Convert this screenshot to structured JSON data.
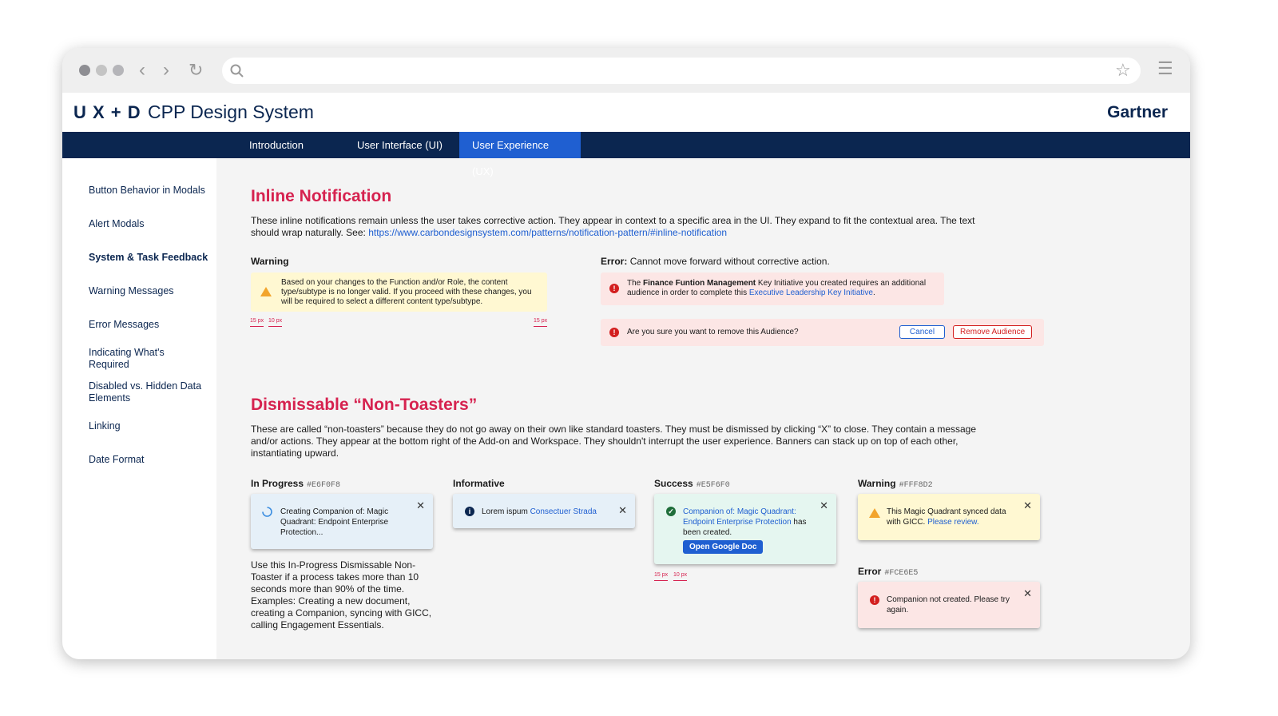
{
  "app": {
    "title": "CPP Design System",
    "logo": "U X + D",
    "brand": "Gartner"
  },
  "nav": {
    "tabs": [
      {
        "label": "Introduction"
      },
      {
        "label": "User Interface (UI)"
      },
      {
        "label": "User Experience (UX)",
        "active": true
      }
    ]
  },
  "sidebar": {
    "items": [
      {
        "label": "Button Behavior in Modals"
      },
      {
        "label": "Alert Modals"
      },
      {
        "label": "System & Task Feedback",
        "active": true
      },
      {
        "label": "Warning Messages"
      },
      {
        "label": "Error Messages"
      },
      {
        "label": "Indicating What's Required"
      },
      {
        "label": "Disabled vs. Hidden Data Elements"
      },
      {
        "label": "Linking"
      },
      {
        "label": "Date Format"
      }
    ]
  },
  "inline": {
    "title": "Inline Notification",
    "desc": "These inline notifications remain unless the user takes corrective action. They appear in context to a specific area in the UI. They expand to fit the contextual area. The text should wrap naturally. See: ",
    "link": "https://www.carbondesignsystem.com/patterns/notification-pattern/#inline-notification",
    "warning_label": "Warning",
    "warning_text": "Based on your changes to the Function and/or Role, the content type/subtype is no longer valid. If you proceed with these changes, you will be required to select a different content type/subtype.",
    "measure": [
      "15 px",
      "10 px",
      "15 px"
    ],
    "error_label_bold": "Error:",
    "error_label": "Cannot move forward without corrective action.",
    "error1": {
      "pre": "The ",
      "bold": "Finance Funtion Management",
      "mid": " Key Initiative you created requires an additional audience in order to complete this ",
      "link": "Executive Leadership Key Initiative",
      "post": "."
    },
    "error2": {
      "text": "Are you sure you want to remove this Audience?",
      "cancel": "Cancel",
      "remove": "Remove Audience"
    }
  },
  "toasters": {
    "title": "Dismissable “Non-Toasters”",
    "desc": "These are called “non-toasters” because they do not go away on their own like standard toasters. They must be dismissed by clicking “X” to close. They contain a message and/or actions. They appear at the bottom right of the Add-on and Workspace. They shouldn't interrupt the user experience. Banners can stack up on top of each other, instantiating upward.",
    "progress": {
      "label": "In Progress",
      "hex": "#E6F0F8",
      "text": "Creating Companion of: Magic Quadrant: Endpoint Enterprise Protection...",
      "note": "Use this In-Progress Dismissable Non-Toaster if a process takes more than 10 seconds more than 90% of the time. Examples: Creating a new document, creating a Companion, syncing with GICC, calling Engagement Essentials."
    },
    "info": {
      "label": "Informative",
      "text": "Lorem ispum ",
      "link": "Consectuer Strada"
    },
    "success": {
      "label": "Success",
      "hex": "#E5F6F0",
      "link": "Companion of: Magic Quadrant: Endpoint Enterprise Protection",
      "text": " has been created.",
      "button": "Open Google Doc",
      "measure": [
        "15 px",
        "10 px"
      ]
    },
    "warning": {
      "label": "Warning",
      "hex": "#FFF8D2",
      "text": "This Magic Quadrant synced data with GICC. ",
      "link": "Please review."
    },
    "error": {
      "label": "Error",
      "hex": "#FCE6E5",
      "text": "Companion not created. Please try again."
    },
    "close": "✕"
  }
}
